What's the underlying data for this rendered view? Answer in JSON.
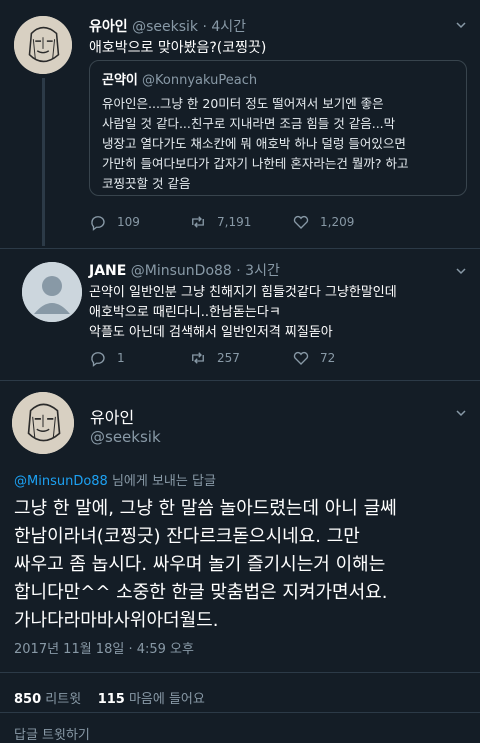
{
  "tweets": [
    {
      "name": "유아인",
      "handle": "@seeksik",
      "time": "· 4시간",
      "text": "애호박으로 맞아봤음?(코찡끗)",
      "quote": {
        "name": "곤약이",
        "handle": "@KonnyakuPeach",
        "lines": [
          "유아인은...그냥 한 20미터 정도 떨어져서 보기엔 좋은",
          "사람일 것 같다...친구로 지내라면 조금 힘들 것 같음...막",
          "냉장고 열다가도 채소칸에 뭐 애호박 하나 덜렁 들어있으면",
          "가만히 들여다보다가 갑자기 나한테 혼자라는건 뭘까? 하고",
          "코찡끗할 것 같음"
        ]
      },
      "replies": "109",
      "retweets": "7,191",
      "likes": "1,209"
    },
    {
      "name": "JANE",
      "handle": "@MinsunDo88",
      "time": "· 3시간",
      "lines": [
        "곤약이 일반인분 그냥 친해지기 힘들것같다 그냥한말인데",
        "애호박으로 때린다니..한남돋는다ㅋ",
        "악플도 아닌데 검색해서 일반인저격 찌질돋아"
      ],
      "replies": "1",
      "retweets": "257",
      "likes": "72"
    }
  ],
  "main": {
    "name": "유아인",
    "handle": "@seeksik",
    "reply_handle": "@MinsunDo88",
    "reply_suffix": " 님에게 보내는 답글",
    "lines": [
      "그냥 한 말에, 그냥 한 말씀 놀아드렸는데 아니 글쎄",
      "한남이라녀(코찡긋) 잔다르크돋으시네요. 그만",
      "싸우고 좀 놉시다. 싸우며 놀기 즐기시는거 이해는",
      "합니다만^^ 소중한 한글 맞춤법은 지켜가면서요.",
      "가나다라마바사위아더월드."
    ],
    "timestamp": "2017년 11월 18일 · 4:59 오후",
    "retweet_count": "850",
    "retweet_label": " 리트윗",
    "like_count": "115",
    "like_label": " 마음에 들어요",
    "bottom_hint": "답글 트윗하기"
  },
  "colors": {
    "background": "#141d26",
    "muted": "#8899a6",
    "link": "#1da1f2"
  }
}
